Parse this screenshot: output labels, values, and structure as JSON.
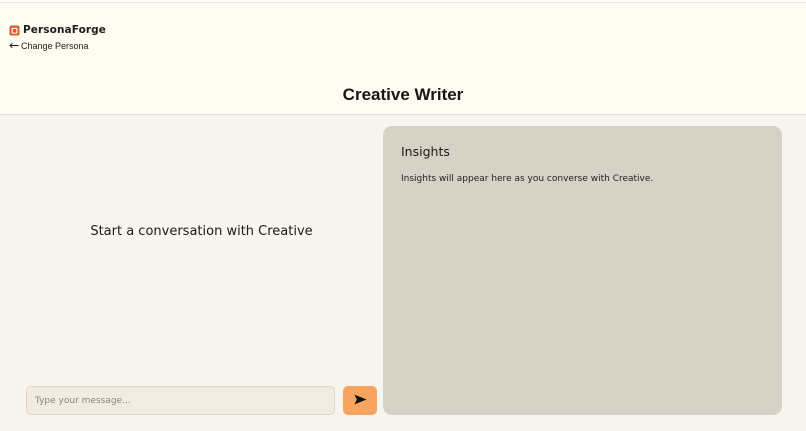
{
  "header": {
    "brand_name": "PersonaForge",
    "change_persona_label": "Change Persona",
    "title": "Creative Writer"
  },
  "chat": {
    "empty_state": "Start a conversation with Creative",
    "input_placeholder": "Type your message...",
    "input_value": "",
    "send_icon": "send-arrow-icon"
  },
  "insights": {
    "title": "Insights",
    "placeholder_text": "Insights will appear here as you converse with Creative."
  },
  "colors": {
    "header_bg": "#fefcf0",
    "page_bg": "#f8f5ef",
    "panel_bg": "#d8d1c5",
    "accent": "#f6a460",
    "logo_accent": "#e0582a"
  }
}
